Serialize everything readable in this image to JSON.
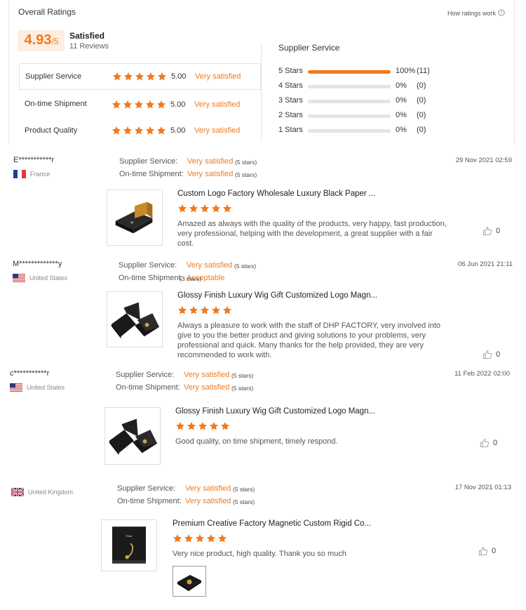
{
  "header": {
    "title": "Overall Ratings",
    "how_link": "How ratings work",
    "score": "4.93",
    "score_suffix": "/5",
    "status": "Satisfied",
    "reviews": "11 Reviews"
  },
  "categories": [
    {
      "label": "Supplier Service",
      "rating": 5,
      "score": "5.00",
      "desc": "Very satisfied"
    },
    {
      "label": "On-time Shipment",
      "rating": 5,
      "score": "5.00",
      "desc": "Very satisfied"
    },
    {
      "label": "Product Quality",
      "rating": 5,
      "score": "5.00",
      "desc": "Very satisfied"
    }
  ],
  "breakdown": {
    "title": "Supplier Service",
    "rows": [
      {
        "label": "5 Stars",
        "fraction": 1.0,
        "pct": "100%",
        "count": "(11)"
      },
      {
        "label": "4 Stars",
        "fraction": 0,
        "pct": "0%",
        "count": "(0)"
      },
      {
        "label": "3 Stars",
        "fraction": 0,
        "pct": "0%",
        "count": "(0)"
      },
      {
        "label": "2 Stars",
        "fraction": 0,
        "pct": "0%",
        "count": "(0)"
      },
      {
        "label": "1 Stars",
        "fraction": 0,
        "pct": "0%",
        "count": "(0)"
      }
    ]
  },
  "reviews": [
    {
      "name": "E***********r",
      "country": "France",
      "flag": "france-flag",
      "date": "29 Nov 2021 02:59",
      "supplier_label": "Supplier Service:",
      "supplier_value": "Very satisfied",
      "supplier_stars": "(5 stars)",
      "shipment_label": "On-time Shipment:",
      "shipment_value": "Very satisfied",
      "shipment_stars": "(5 stars)",
      "product_title": "Custom Logo Factory Wholesale Luxury Black Paper ...",
      "product_rating": 5,
      "text": "Amazed as always with the quality of the products, very happy, fast production, very professional, helping with the development, a great supplier with a fair cost.",
      "likes": "0"
    },
    {
      "name": "M*************y",
      "country": "United States",
      "flag": "us-flag",
      "date": "06 Jun 2021 21:11",
      "supplier_label": "Supplier Service:",
      "supplier_value": "Very satisfied",
      "supplier_stars": "(5 stars)",
      "shipment_label": "On-time Shipment:",
      "shipment_value": "Acceptable",
      "shipment_stars": "(3 stars)",
      "product_title": "Glossy Finish Luxury Wig Gift Customized Logo Magn...",
      "product_rating": 5,
      "text": "Always a pleasure to work with the staff of DHP FACTORY, very involved into give to you the better product and giving solutions to your problems, very professional and quick. Many thanks for the help provided, they are very recommended to work with.",
      "likes": "0"
    },
    {
      "name": "c***********r",
      "country": "United States",
      "flag": "us-flag",
      "date": "11 Feb 2022 02:00",
      "supplier_label": "Supplier Service:",
      "supplier_value": "Very satisfied",
      "supplier_stars": "(5 stars)",
      "shipment_label": "On-time Shipment:",
      "shipment_value": "Very satisfied",
      "shipment_stars": "(5 stars)",
      "product_title": "Glossy Finish Luxury Wig Gift Customized Logo Magn...",
      "product_rating": 5,
      "text": "Good quality, on time shipment, timely respond.",
      "likes": "0"
    },
    {
      "name": "",
      "country": "United Kingdom",
      "flag": "uk-flag",
      "date": "17 Nov 2021 01:13",
      "supplier_label": "Supplier Service:",
      "supplier_value": "Very satisfied",
      "supplier_stars": "(5 stars)",
      "shipment_label": "On-time Shipment:",
      "shipment_value": "Very satisfied",
      "shipment_stars": "(5 stars)",
      "product_title": "Premium Creative Factory Magnetic Custom Rigid Co...",
      "product_rating": 5,
      "text": "Very nice product, high quality. Thank you so much",
      "likes": "0"
    }
  ],
  "colors": {
    "accent": "#f07a1f",
    "score_bg": "#fdeee1",
    "bar_bg": "#e4e4e4"
  }
}
